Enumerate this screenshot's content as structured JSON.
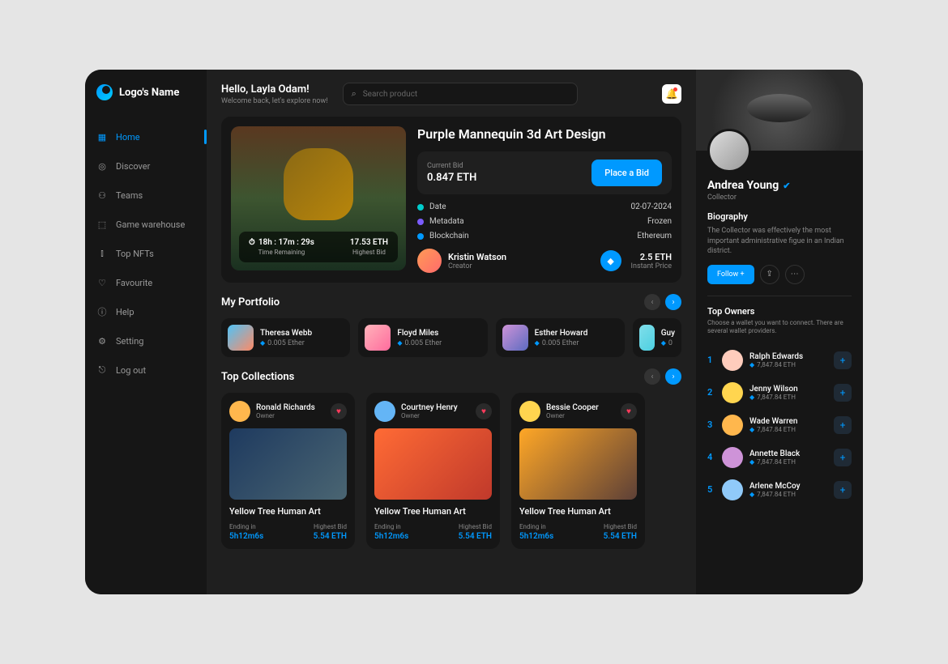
{
  "logo": "Logo's Name",
  "nav": [
    {
      "label": "Home",
      "active": true
    },
    {
      "label": "Discover"
    },
    {
      "label": "Teams"
    },
    {
      "label": "Game warehouse"
    },
    {
      "label": "Top NFTs"
    },
    {
      "label": "Favourite"
    },
    {
      "label": "Help"
    },
    {
      "label": "Setting"
    },
    {
      "label": "Log out"
    }
  ],
  "greeting": {
    "title": "Hello, Layla Odam!",
    "sub": "Welcome back, let's explore now!"
  },
  "search": {
    "placeholder": "Search product"
  },
  "featured": {
    "title": "Purple Mannequin 3d Art  Design",
    "bid_label": "Current Bid",
    "bid_value": "0.847 ETH",
    "bid_button": "Place a Bid",
    "timer_value": "18h : 17m : 29s",
    "timer_label": "Time Remaining",
    "highest_value": "17.53 ETH",
    "highest_label": "Highest Bid",
    "meta": [
      {
        "key": "Date",
        "val": "02-07-2024",
        "color": "#00cccc"
      },
      {
        "key": "Metadata",
        "val": "Frozen",
        "color": "#7b5cff"
      },
      {
        "key": "Blockchain",
        "val": "Ethereum",
        "color": "#0099ff"
      }
    ],
    "creator": {
      "name": "Kristin Watson",
      "role": "Creator"
    },
    "price": {
      "value": "2.5 ETH",
      "label": "Instant Price"
    }
  },
  "portfolio": {
    "title": "My Portfolio",
    "items": [
      {
        "name": "Theresa Webb",
        "price": "0.005 Ether"
      },
      {
        "name": "Floyd Miles",
        "price": "0.005 Ether"
      },
      {
        "name": "Esther Howard",
        "price": "0.005 Ether"
      },
      {
        "name": "Guy",
        "price": "0"
      }
    ]
  },
  "collections": {
    "title": "Top Collections",
    "items": [
      {
        "owner": "Ronald Richards",
        "role": "Owner",
        "title": "Yellow Tree Human Art",
        "ending_lbl": "Ending in",
        "ending": "5h12m6s",
        "bid_lbl": "Highest Bid",
        "bid": "5.54 ETH",
        "avatar": "#ffb74d"
      },
      {
        "owner": "Courtney Henry",
        "role": "Owner",
        "title": "Yellow Tree Human Art",
        "ending_lbl": "Ending in",
        "ending": "5h12m6s",
        "bid_lbl": "Highest Bid",
        "bid": "5.54 ETH",
        "avatar": "#64b5f6"
      },
      {
        "owner": "Bessie Cooper",
        "role": "Owner",
        "title": "Yellow Tree Human Art",
        "ending_lbl": "Ending in",
        "ending": "5h12m6s",
        "bid_lbl": "Highest Bid",
        "bid": "5.54 ETH",
        "avatar": "#ffd54f"
      }
    ]
  },
  "profile": {
    "name": "Andrea Young",
    "role": "Collector",
    "bio_title": "Biography",
    "bio_text": "The Collector was effectively the most important administrative figue in an Indian district.",
    "follow": "Follow +"
  },
  "owners": {
    "title": "Top Owners",
    "sub": "Choose a wallet you want to connect. There are several wallet providers.",
    "list": [
      {
        "rank": "1",
        "name": "Ralph Edwards",
        "eth": "7,847.84 ETH",
        "color": "#ffccbc"
      },
      {
        "rank": "2",
        "name": "Jenny Wilson",
        "eth": "7,847.84 ETH",
        "color": "#ffd54f"
      },
      {
        "rank": "3",
        "name": "Wade Warren",
        "eth": "7,847.84 ETH",
        "color": "#ffb74d"
      },
      {
        "rank": "4",
        "name": "Annette Black",
        "eth": "7,847.84 ETH",
        "color": "#ce93d8"
      },
      {
        "rank": "5",
        "name": "Arlene McCoy",
        "eth": "7,847.84 ETH",
        "color": "#90caf9"
      }
    ]
  }
}
